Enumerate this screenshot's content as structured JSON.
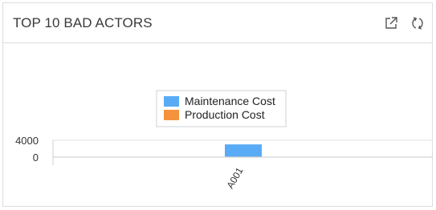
{
  "widget": {
    "title": "TOP 10 BAD ACTORS",
    "actions": [
      {
        "icon": "open-external-icon"
      },
      {
        "icon": "refresh-icon"
      }
    ]
  },
  "chart_data": {
    "type": "bar",
    "stacked": true,
    "categories": [
      "A001"
    ],
    "series": [
      {
        "name": "Maintenance Cost",
        "color": "#5aabf5",
        "values": [
          2900
        ]
      },
      {
        "name": "Production Cost",
        "color": "#f5923e",
        "values": [
          120
        ]
      }
    ],
    "ylim": [
      0,
      4000
    ],
    "y_ticks": [
      {
        "value": 0,
        "label": "0"
      },
      {
        "value": 4000,
        "label": "4000"
      }
    ],
    "x_tick_rotation": -60,
    "legend_position": "top-center",
    "grid": false,
    "title": "",
    "xlabel": "",
    "ylabel": ""
  }
}
